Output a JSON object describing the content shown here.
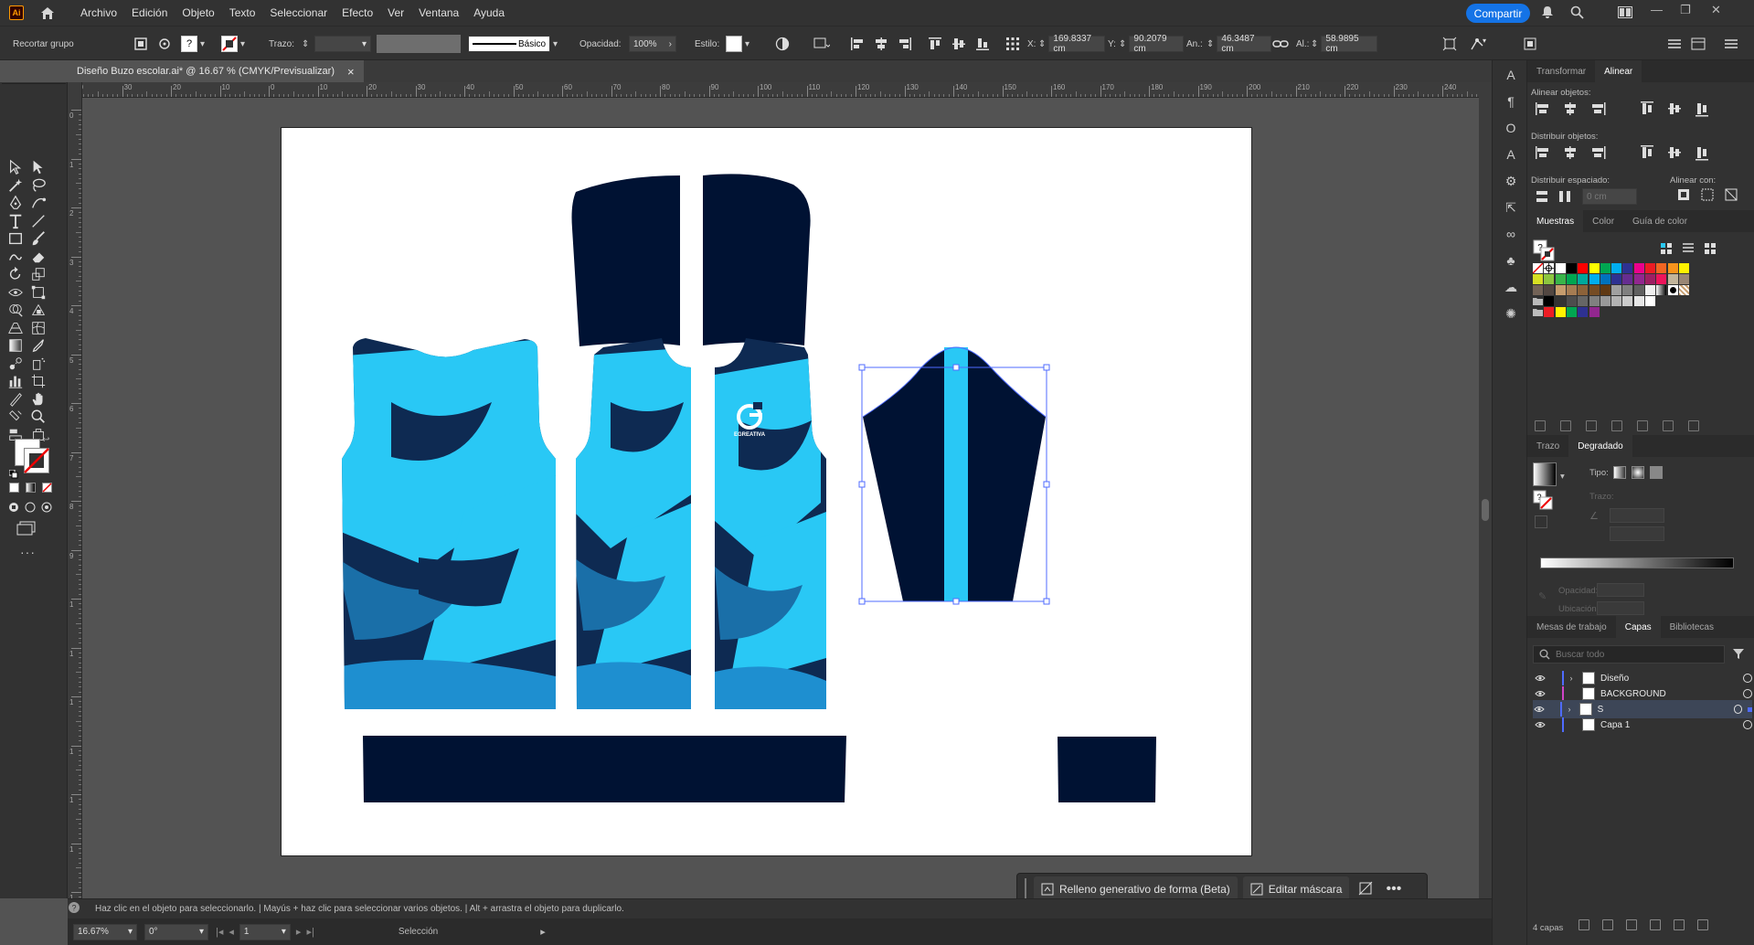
{
  "app": {
    "logo": "Ai",
    "share_label": "Compartir"
  },
  "menu": [
    "Archivo",
    "Edición",
    "Objeto",
    "Texto",
    "Seleccionar",
    "Efecto",
    "Ver",
    "Ventana",
    "Ayuda"
  ],
  "control": {
    "context": "Recortar grupo",
    "stroke_label": "Trazo:",
    "brush_label": "Básico",
    "opacity_label": "Opacidad:",
    "opacity_value": "100%",
    "style_label": "Estilo:",
    "x_label": "X:",
    "x_value": "169.8337 cm",
    "y_label": "Y:",
    "y_value": "90.2079 cm",
    "w_label": "An.:",
    "w_value": "46.3487 cm",
    "h_label": "Al.:",
    "h_value": "58.9895 cm"
  },
  "document": {
    "tab_title": "Diseño Buzo escolar.ai* @ 16.67 % (CMYK/Previsualizar)",
    "close": "×"
  },
  "ruler_h": [
    "40",
    "30",
    "20",
    "10",
    "0",
    "10",
    "20",
    "30",
    "40",
    "50",
    "60",
    "70",
    "80",
    "90",
    "100",
    "110",
    "120",
    "130",
    "140",
    "150",
    "160",
    "170",
    "180",
    "190",
    "200",
    "210",
    "220",
    "230",
    "240"
  ],
  "ruler_v": [
    "0",
    "1",
    "2",
    "3",
    "4",
    "5",
    "6",
    "7",
    "8",
    "9",
    "1",
    "1",
    "1",
    "1",
    "1",
    "1",
    "1",
    "1"
  ],
  "artwork": {
    "logo_text": "EGREATIVA"
  },
  "taskbar": {
    "generative_fill": "Relleno generativo de forma (Beta)",
    "edit_mask": "Editar máscara"
  },
  "status": {
    "hint": "Haz clic en el objeto para seleccionarlo.  |  Mayús + haz clic para seleccionar varios objetos.  |  Alt + arrastra el objeto para duplicarlo.",
    "zoom": "16.67%",
    "rotation": "0°",
    "artboard": "1",
    "tool": "Selección"
  },
  "align_panel": {
    "tabs": [
      "Transformar",
      "Alinear"
    ],
    "align_objects": "Alinear objetos:",
    "distribute_objects": "Distribuir objetos:",
    "distribute_spacing": "Distribuir espaciado:",
    "align_to": "Alinear con:",
    "spacing_value": "0 cm"
  },
  "swatch_panel": {
    "tabs": [
      "Muestras",
      "Color",
      "Guía de color"
    ]
  },
  "gradient_panel": {
    "tabs": [
      "Trazo",
      "Degradado"
    ],
    "type_label": "Tipo:",
    "stroke_label": "Trazo:",
    "opacity_label": "Opacidad:",
    "location_label": "Ubicación:"
  },
  "layers_panel": {
    "tabs": [
      "Mesas de trabajo",
      "Capas",
      "Bibliotecas"
    ],
    "search_placeholder": "Buscar todo",
    "layers": [
      {
        "name": "Diseño",
        "color": "#4f6bff",
        "expand": true,
        "selected": false
      },
      {
        "name": "BACKGROUND",
        "color": "#d044c8",
        "expand": false,
        "selected": false
      },
      {
        "name": "S",
        "color": "#4f6bff",
        "expand": true,
        "selected": true
      },
      {
        "name": "Capa 1",
        "color": "#4f6bff",
        "expand": false,
        "selected": false
      }
    ],
    "count": "4 capas"
  },
  "colors": {
    "navy": "#001233",
    "cyan": "#29c8f5",
    "accent": "#1473e6"
  }
}
